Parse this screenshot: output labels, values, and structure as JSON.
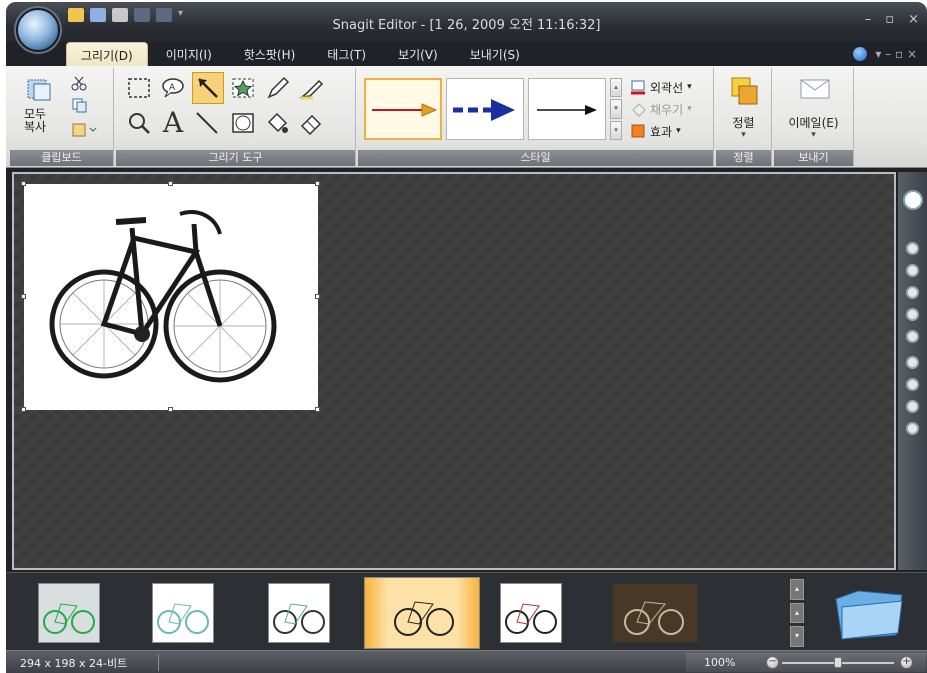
{
  "window": {
    "title": "Snagit Editor - [1 26, 2009 오전 11:16:32]"
  },
  "window_controls": {
    "minimize": "–",
    "maximize": "▫",
    "close": "×"
  },
  "tabs": [
    {
      "label": "그리기(D)",
      "active": true
    },
    {
      "label": "이미지(I)",
      "active": false
    },
    {
      "label": "핫스팟(H)",
      "active": false
    },
    {
      "label": "태그(T)",
      "active": false
    },
    {
      "label": "보기(V)",
      "active": false
    },
    {
      "label": "보내기(S)",
      "active": false
    }
  ],
  "ribbon": {
    "clipboard": {
      "label": "클립보드",
      "copy_all_line1": "모두",
      "copy_all_line2": "복사"
    },
    "drawing_tools": {
      "label": "그리기 도구",
      "text_tool_glyph": "A"
    },
    "styles": {
      "label": "스타일",
      "outline": "외곽선",
      "fill": "채우기",
      "effects": "효과",
      "dropdown": "▾"
    },
    "arrange": {
      "group_label": "정렬",
      "button_label": "정렬"
    },
    "send": {
      "group_label": "보내기",
      "email_label": "이메일(E)"
    }
  },
  "status": {
    "info": "294 x 198 x 24-비트",
    "zoom": "100%"
  },
  "colors": {
    "accent": "#f0b040",
    "arrow_red": "#c0181c",
    "arrow_blue": "#1a2fa0",
    "canvas_bg": "#3b3b3b"
  }
}
